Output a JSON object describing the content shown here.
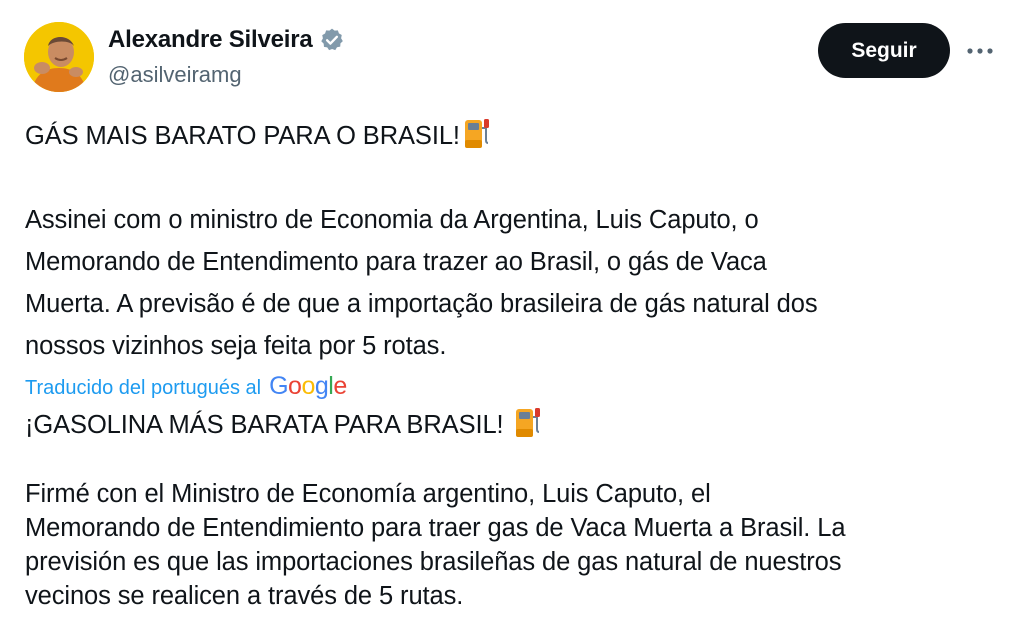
{
  "author": {
    "name": "Alexandre Silveira",
    "handle": "@asilveiramg",
    "verified_icon": "verified-badge-icon"
  },
  "actions": {
    "follow_label": "Seguir",
    "more_icon": "more-dots-icon"
  },
  "tweet": {
    "headline": "GÁS MAIS BARATO PARA O BRASIL!",
    "body_lines": [
      "Assinei com o ministro de Economia da Argentina, Luis Caputo, o",
      "Memorando de Entendimento para trazer ao Brasil, o gás de Vaca",
      "Muerta. A previsão é de que a importação brasileira de gás natural dos",
      "nossos vizinhos seja feita por 5 rotas."
    ]
  },
  "translation": {
    "notice": "Traducido del portugués al",
    "provider": "Google",
    "headline": "¡GASOLINA MÁS BARATA PARA BRASIL!",
    "body_lines": [
      "Firmé con el Ministro de Economía argentino, Luis Caputo, el",
      "Memorando de Entendimiento para traer gas de Vaca Muerta a Brasil. La",
      "previsión es que las importaciones brasileñas de gas natural de nuestros",
      "vecinos se realicen a través de 5 rutas."
    ]
  },
  "colors": {
    "accent": "#1d9bf0",
    "text": "#0f1419",
    "secondary": "#536471",
    "follow_bg": "#0f1419"
  },
  "emoji": "fuel-pump-icon"
}
